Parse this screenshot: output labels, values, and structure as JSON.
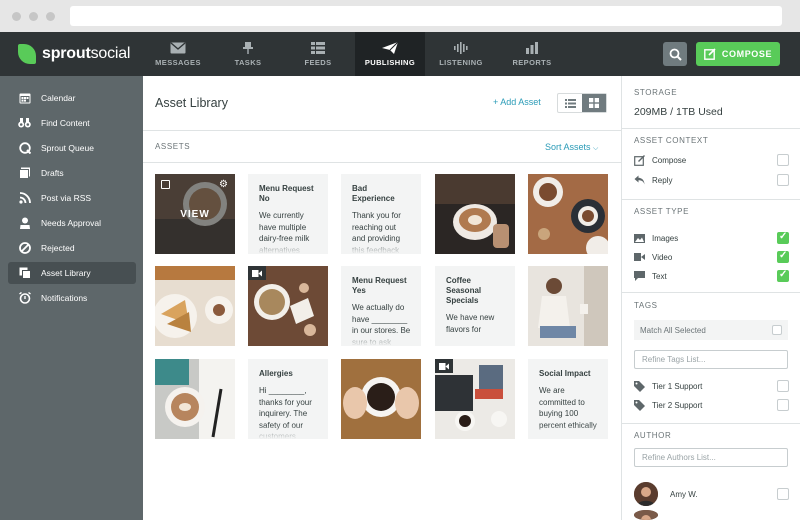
{
  "app": {
    "logo_text_bold": "sprout",
    "logo_text_light": "social"
  },
  "nav": {
    "items": [
      {
        "label": "MESSAGES",
        "icon": "envelope-icon"
      },
      {
        "label": "TASKS",
        "icon": "pin-icon"
      },
      {
        "label": "FEEDS",
        "icon": "feeds-icon"
      },
      {
        "label": "PUBLISHING",
        "icon": "paper-plane-icon",
        "active": true
      },
      {
        "label": "LISTENING",
        "icon": "soundwave-icon"
      },
      {
        "label": "REPORTS",
        "icon": "bar-chart-icon"
      }
    ],
    "compose_label": "COMPOSE"
  },
  "sidebar": {
    "items": [
      {
        "label": "Calendar",
        "icon": "calendar-icon"
      },
      {
        "label": "Find Content",
        "icon": "binoculars-icon"
      },
      {
        "label": "Sprout Queue",
        "icon": "queue-icon"
      },
      {
        "label": "Drafts",
        "icon": "drafts-icon"
      },
      {
        "label": "Post via RSS",
        "icon": "rss-icon"
      },
      {
        "label": "Needs Approval",
        "icon": "approval-icon"
      },
      {
        "label": "Rejected",
        "icon": "rejected-icon"
      },
      {
        "label": "Asset Library",
        "icon": "asset-library-icon",
        "active": true
      },
      {
        "label": "Notifications",
        "icon": "alarm-icon"
      }
    ]
  },
  "main": {
    "title": "Asset Library",
    "add_asset": "+ Add Asset",
    "assets_label": "ASSETS",
    "sort_label": "Sort Assets",
    "hover_label": "VIEW",
    "text_tiles": [
      {
        "title": "Menu Request No",
        "body": "We currently have multiple dairy-free milk alternatives"
      },
      {
        "title": "Bad Experience",
        "body": "Thank you for reaching out and providing this feedback"
      },
      {
        "title": "Menu Request Yes",
        "body": "We actually do have ________ in our stores. Be sure to ask"
      },
      {
        "title": "Coffee Seasonal Specials",
        "body": "We have new flavors for"
      },
      {
        "title": "Allergies",
        "body": "Hi ________, thanks for your inquirery. The safety of our customers"
      },
      {
        "title": "Social Impact",
        "body": "We are committed to buying 100 percent ethically"
      }
    ]
  },
  "panel": {
    "storage_heading": "STORAGE",
    "storage_value": "209MB / 1TB Used",
    "context_heading": "ASSET CONTEXT",
    "context_items": [
      {
        "label": "Compose",
        "icon": "edit-icon",
        "checked": false
      },
      {
        "label": "Reply",
        "icon": "reply-icon",
        "checked": false
      }
    ],
    "type_heading": "ASSET TYPE",
    "type_items": [
      {
        "label": "Images",
        "icon": "image-icon",
        "checked": true
      },
      {
        "label": "Video",
        "icon": "video-icon",
        "checked": true
      },
      {
        "label": "Text",
        "icon": "text-bubble-icon",
        "checked": true
      }
    ],
    "tags_heading": "TAGS",
    "match_all": "Match All Selected",
    "refine_tags_placeholder": "Refine Tags List...",
    "tag_items": [
      {
        "label": "Tier 1 Support",
        "icon": "tag-icon",
        "checked": false
      },
      {
        "label": "Tier 2 Support",
        "icon": "tag-icon",
        "checked": false
      }
    ],
    "author_heading": "AUTHOR",
    "refine_authors_placeholder": "Refine Authors List...",
    "authors": [
      {
        "name": "Amy W.",
        "checked": false
      }
    ]
  },
  "colors": {
    "accent_green": "#59cb59",
    "link_blue": "#2a9bb7",
    "nav_dark": "#2f3436",
    "sidebar": "#5e676a"
  }
}
